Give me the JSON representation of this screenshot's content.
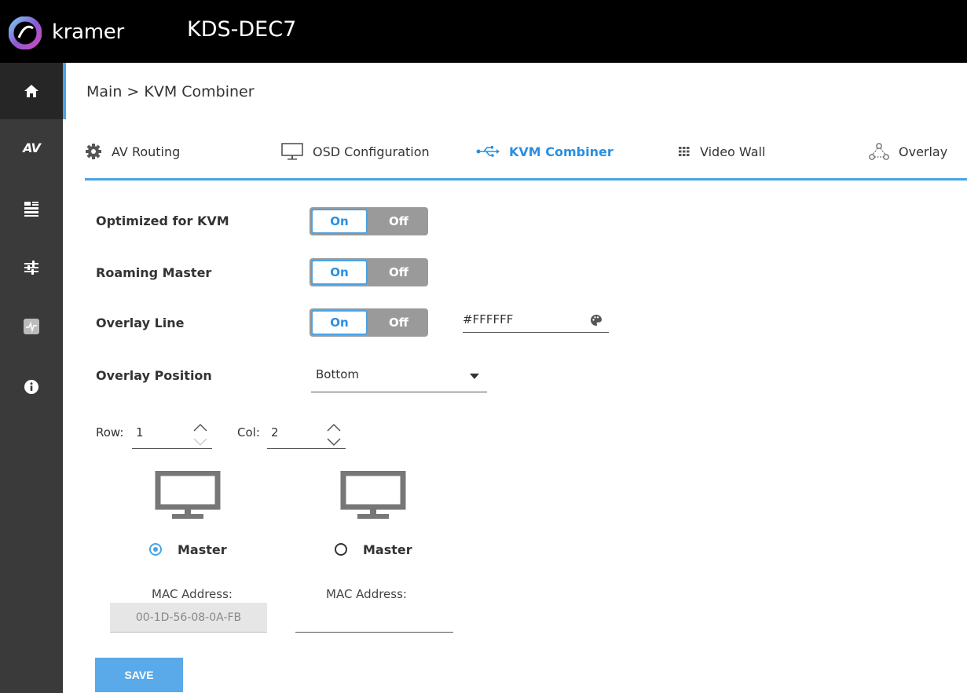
{
  "header": {
    "brand": "kramer",
    "device": "KDS-DEC7"
  },
  "sidebar": {
    "items": [
      {
        "icon": "home-icon"
      },
      {
        "icon": "av-icon",
        "text": "AV"
      },
      {
        "icon": "device-settings-icon"
      },
      {
        "icon": "sliders-icon"
      },
      {
        "icon": "diagnostics-icon"
      },
      {
        "icon": "info-icon"
      }
    ]
  },
  "breadcrumb": "Main > KVM Combiner",
  "tabs": [
    {
      "label": "AV Routing",
      "icon": "gear-icon"
    },
    {
      "label": "OSD Configuration",
      "icon": "monitor-icon"
    },
    {
      "label": "KVM Combiner",
      "icon": "usb-icon",
      "active": true
    },
    {
      "label": "Video Wall",
      "icon": "grid-icon"
    },
    {
      "label": "Overlay",
      "icon": "overlay-icon"
    }
  ],
  "form": {
    "optimized": {
      "label": "Optimized for KVM",
      "on": "On",
      "off": "Off",
      "value": "On"
    },
    "roaming": {
      "label": "Roaming Master",
      "on": "On",
      "off": "Off",
      "value": "On"
    },
    "overlay_line": {
      "label": "Overlay Line",
      "on": "On",
      "off": "Off",
      "value": "On",
      "color": "#FFFFFF"
    },
    "overlay_position": {
      "label": "Overlay Position",
      "value": "Bottom"
    },
    "row": {
      "label": "Row:",
      "value": "1"
    },
    "col": {
      "label": "Col:",
      "value": "2"
    }
  },
  "screens": [
    {
      "master_label": "Master",
      "selected": true,
      "mac_label": "MAC Address:",
      "mac_value": "00-1D-56-08-0A-FB"
    },
    {
      "master_label": "Master",
      "selected": false,
      "mac_label": "MAC Address:",
      "mac_value": ""
    }
  ],
  "save_label": "SAVE",
  "colors": {
    "accent": "#4aa3e6",
    "active_text": "#2a8fe0",
    "sidebar": "#3a3a3a",
    "toggle_off": "#9a9a9a"
  }
}
